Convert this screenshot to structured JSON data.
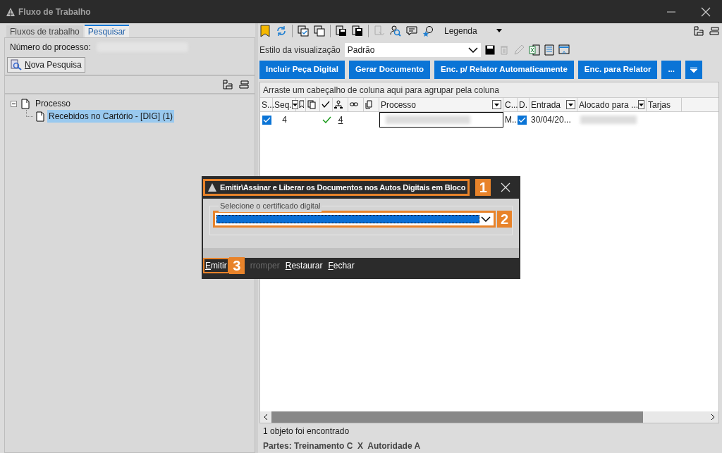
{
  "window": {
    "title": "Fluxo de Trabalho"
  },
  "tabs": [
    {
      "label": "Fluxos de trabalho",
      "selected": false
    },
    {
      "label": "Pesquisar",
      "selected": true
    }
  ],
  "search": {
    "process_number_label": "Número do processo:",
    "new_search_button": "Nova Pesquisa"
  },
  "tree": [
    {
      "label": "Processo",
      "expanded": true,
      "selected": false,
      "children": [
        {
          "label": "Recebidos no Cartório - [DIG] (1)",
          "selected": true
        }
      ]
    }
  ],
  "toolbar": {
    "legend": "Legenda"
  },
  "view_style": {
    "label": "Estilo da visualização",
    "value": "Padrão"
  },
  "action_buttons": [
    "Incluir Peça Digital",
    "Gerar Documento",
    "Enc. p/ Relator Automaticamente",
    "Enc. para Relator",
    "..."
  ],
  "group_hint": "Arraste um cabeçalho de coluna aqui para agrupar pela coluna",
  "columns": [
    {
      "kind": "text",
      "label": "S..."
    },
    {
      "kind": "text",
      "label": "Seq.",
      "filter": true
    },
    {
      "kind": "bookmark"
    },
    {
      "kind": "copies"
    },
    {
      "kind": "check"
    },
    {
      "kind": "tree"
    },
    {
      "kind": "link"
    },
    {
      "kind": "doc"
    },
    {
      "kind": "text",
      "label": "Processo",
      "filter": true
    },
    {
      "kind": "text",
      "label": "C..."
    },
    {
      "kind": "text",
      "label": "D."
    },
    {
      "kind": "text",
      "label": "Entrada",
      "filter": true
    },
    {
      "kind": "text",
      "label": "Alocado para ...",
      "filter": true
    },
    {
      "kind": "text",
      "label": "Tarjas"
    }
  ],
  "rows": [
    {
      "checked": true,
      "seq": "4",
      "done": true,
      "count": "4",
      "c": "M...",
      "d_checked": true,
      "entrada": "30/04/20..."
    }
  ],
  "status": "1 objeto foi encontrado",
  "parties": "Partes: Treinamento C  X  Autoridade A",
  "dialog": {
    "title": "Emitir\\Assinar e Liberar os Documentos nos Autos Digitais em Bloco",
    "group_label": "Selecione o certificado digital",
    "buttons": [
      {
        "label": "Emitir",
        "disabled": false
      },
      {
        "label": "rromper",
        "disabled": true
      },
      {
        "label": "Restaurar",
        "disabled": false
      },
      {
        "label": "Fechar",
        "disabled": false
      }
    ],
    "callouts": [
      "1",
      "2",
      "3"
    ]
  }
}
